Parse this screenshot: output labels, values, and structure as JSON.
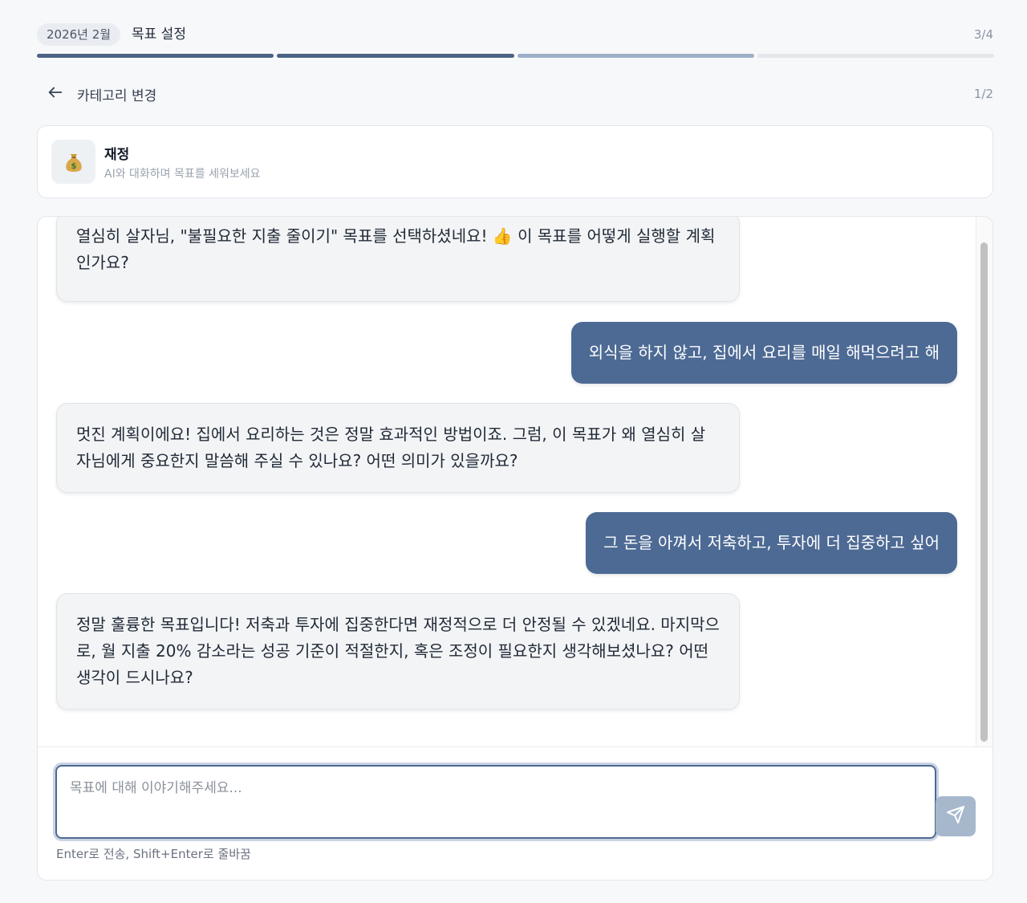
{
  "header": {
    "month": "2026년 2월",
    "step_title": "목표 설정",
    "step_count": "3/4",
    "progress_segments": [
      "done",
      "done",
      "current",
      "pending"
    ]
  },
  "nav": {
    "back_label": "카테고리 변경",
    "sub_count": "1/2"
  },
  "category": {
    "icon": "money-bag-icon",
    "icon_glyph": "💰",
    "name": "재정",
    "description": "AI와 대화하며 목표를 세워보세요"
  },
  "chat": {
    "messages": [
      {
        "role": "ai",
        "text": "열심히 살자님, \"불필요한 지출 줄이기\" 목표를 선택하셨네요! 👍 이 목표를 어떻게 실행할 계획인가요?"
      },
      {
        "role": "user",
        "text": "외식을 하지 않고, 집에서 요리를 매일 해먹으려고 해"
      },
      {
        "role": "ai",
        "text": "멋진 계획이에요! 집에서 요리하는 것은 정말 효과적인 방법이죠. 그럼, 이 목표가 왜 열심히 살자님에게 중요한지 말씀해 주실 수 있나요? 어떤 의미가 있을까요?"
      },
      {
        "role": "user",
        "text": "그 돈을 아껴서 저축하고, 투자에 더 집중하고 싶어"
      },
      {
        "role": "ai",
        "text": "정말 훌륭한 목표입니다! 저축과 투자에 집중한다면 재정적으로 더 안정될 수 있겠네요. 마지막으로, 월 지출 20% 감소라는 성공 기준이 적절한지, 혹은 조정이 필요한지 생각해보셨나요? 어떤 생각이 드시나요?"
      }
    ]
  },
  "input": {
    "placeholder": "목표에 대해 이야기해주세요...",
    "value": "",
    "hint": "Enter로 전송, Shift+Enter로 줄바꿈",
    "send_icon": "send-icon"
  },
  "colors": {
    "accent": "#4d6a94",
    "progress_done": "#4a6285",
    "progress_current": "#9db0c8",
    "send_button": "#a7b8cd"
  }
}
